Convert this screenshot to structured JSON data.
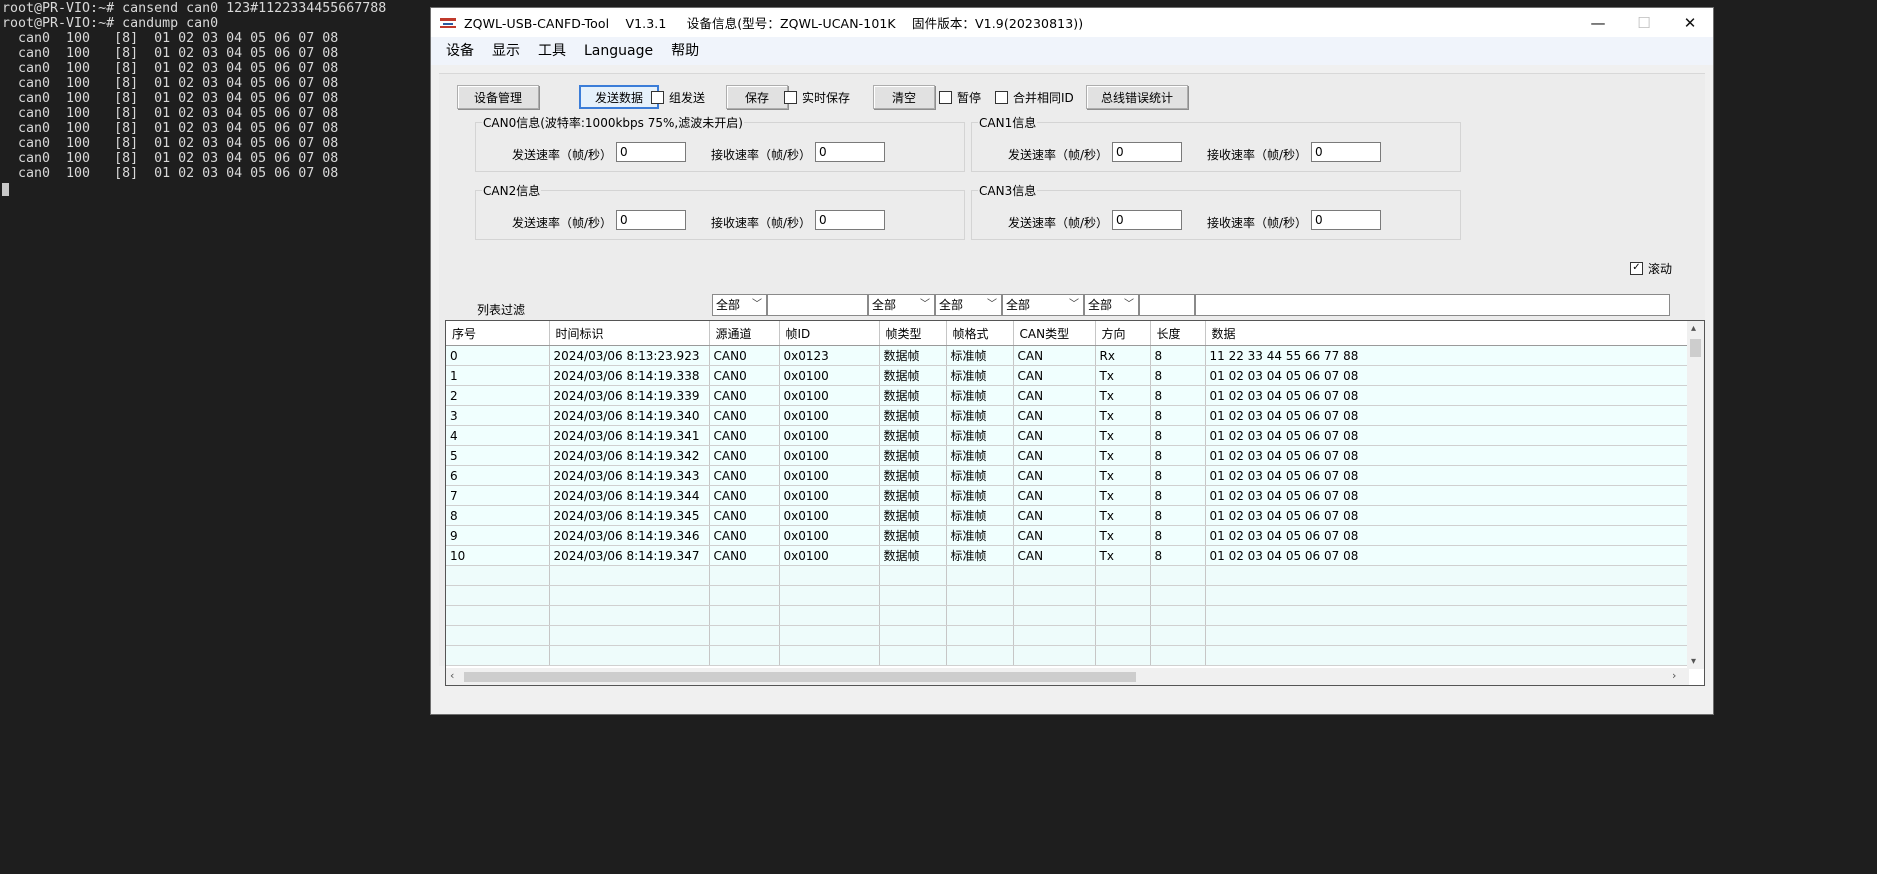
{
  "terminal": {
    "lines": [
      "root@PR-VIO:~# cansend can0 123#1122334455667788",
      "root@PR-VIO:~# candump can0",
      "  can0  100   [8]  01 02 03 04 05 06 07 08",
      "  can0  100   [8]  01 02 03 04 05 06 07 08",
      "  can0  100   [8]  01 02 03 04 05 06 07 08",
      "  can0  100   [8]  01 02 03 04 05 06 07 08",
      "  can0  100   [8]  01 02 03 04 05 06 07 08",
      "  can0  100   [8]  01 02 03 04 05 06 07 08",
      "  can0  100   [8]  01 02 03 04 05 06 07 08",
      "  can0  100   [8]  01 02 03 04 05 06 07 08",
      "  can0  100   [8]  01 02 03 04 05 06 07 08",
      "  can0  100   [8]  01 02 03 04 05 06 07 08"
    ]
  },
  "window": {
    "title": "ZQWL-USB-CANFD-Tool    V1.3.1     设备信息(型号：ZQWL-UCAN-101K    固件版本：V1.9(20230813))",
    "controls": {
      "minimize": "—",
      "maximize": "☐",
      "close": "✕"
    }
  },
  "menu": [
    "设备",
    "显示",
    "工具",
    "Language",
    "帮助"
  ],
  "toolbar": {
    "device_manage": "设备管理",
    "send_data": "发送数据",
    "group_send": "组发送",
    "save": "保存",
    "realtime_save": "实时保存",
    "clear": "清空",
    "pause": "暂停",
    "merge_id": "合并相同ID",
    "bus_error_stats": "总线错误统计"
  },
  "channels": [
    {
      "title": "CAN0信息(波特率:1000kbps 75%,滤波未开启)",
      "send_label": "发送速率（帧/秒）",
      "send_value": "0",
      "recv_label": "接收速率（帧/秒）",
      "recv_value": "0"
    },
    {
      "title": "CAN1信息",
      "send_label": "发送速率（帧/秒）",
      "send_value": "0",
      "recv_label": "接收速率（帧/秒）",
      "recv_value": "0"
    },
    {
      "title": "CAN2信息",
      "send_label": "发送速率（帧/秒）",
      "send_value": "0",
      "recv_label": "接收速率（帧/秒）",
      "recv_value": "0"
    },
    {
      "title": "CAN3信息",
      "send_label": "发送速率（帧/秒）",
      "send_value": "0",
      "recv_label": "接收速率（帧/秒）",
      "recv_value": "0"
    }
  ],
  "scroll_label": "滚动",
  "filter": {
    "label": "列表过滤",
    "channel": "全部",
    "id": "",
    "frame_type": "全部",
    "frame_format": "全部",
    "can_type": "全部",
    "direction": "全部",
    "length": "",
    "data": ""
  },
  "table": {
    "headers": [
      "序号",
      "时间标识",
      "源通道",
      "帧ID",
      "帧类型",
      "帧格式",
      "CAN类型",
      "方向",
      "长度",
      "数据"
    ],
    "rows": [
      [
        "0",
        "2024/03/06 8:13:23.923",
        "CAN0",
        "0x0123",
        "数据帧",
        "标准帧",
        "CAN",
        "Rx",
        "8",
        "11 22 33 44 55 66 77 88"
      ],
      [
        "1",
        "2024/03/06 8:14:19.338",
        "CAN0",
        "0x0100",
        "数据帧",
        "标准帧",
        "CAN",
        "Tx",
        "8",
        "01 02 03 04 05 06 07 08"
      ],
      [
        "2",
        "2024/03/06 8:14:19.339",
        "CAN0",
        "0x0100",
        "数据帧",
        "标准帧",
        "CAN",
        "Tx",
        "8",
        "01 02 03 04 05 06 07 08"
      ],
      [
        "3",
        "2024/03/06 8:14:19.340",
        "CAN0",
        "0x0100",
        "数据帧",
        "标准帧",
        "CAN",
        "Tx",
        "8",
        "01 02 03 04 05 06 07 08"
      ],
      [
        "4",
        "2024/03/06 8:14:19.341",
        "CAN0",
        "0x0100",
        "数据帧",
        "标准帧",
        "CAN",
        "Tx",
        "8",
        "01 02 03 04 05 06 07 08"
      ],
      [
        "5",
        "2024/03/06 8:14:19.342",
        "CAN0",
        "0x0100",
        "数据帧",
        "标准帧",
        "CAN",
        "Tx",
        "8",
        "01 02 03 04 05 06 07 08"
      ],
      [
        "6",
        "2024/03/06 8:14:19.343",
        "CAN0",
        "0x0100",
        "数据帧",
        "标准帧",
        "CAN",
        "Tx",
        "8",
        "01 02 03 04 05 06 07 08"
      ],
      [
        "7",
        "2024/03/06 8:14:19.344",
        "CAN0",
        "0x0100",
        "数据帧",
        "标准帧",
        "CAN",
        "Tx",
        "8",
        "01 02 03 04 05 06 07 08"
      ],
      [
        "8",
        "2024/03/06 8:14:19.345",
        "CAN0",
        "0x0100",
        "数据帧",
        "标准帧",
        "CAN",
        "Tx",
        "8",
        "01 02 03 04 05 06 07 08"
      ],
      [
        "9",
        "2024/03/06 8:14:19.346",
        "CAN0",
        "0x0100",
        "数据帧",
        "标准帧",
        "CAN",
        "Tx",
        "8",
        "01 02 03 04 05 06 07 08"
      ],
      [
        "10",
        "2024/03/06 8:14:19.347",
        "CAN0",
        "0x0100",
        "数据帧",
        "标准帧",
        "CAN",
        "Tx",
        "8",
        "01 02 03 04 05 06 07 08"
      ]
    ]
  },
  "colors": {
    "terminal_bg": "#1e1e1e",
    "row_tint": "#f0fffe",
    "focus_accent": "#3b7dd8"
  }
}
